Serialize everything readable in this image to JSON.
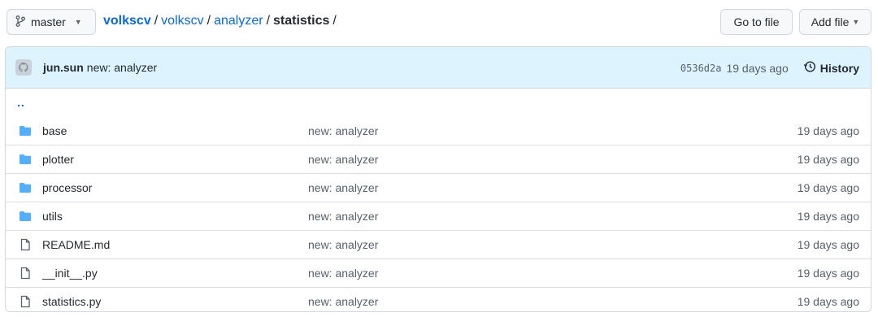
{
  "branch": {
    "label": "master"
  },
  "breadcrumb": {
    "owner": "volkscv",
    "repo": "volkscv",
    "folder": "analyzer",
    "current": "statistics",
    "sep": "/"
  },
  "buttons": {
    "goto_file": "Go to file",
    "add_file": "Add file"
  },
  "commit": {
    "author": "jun.sun",
    "message": "new: analyzer",
    "sha": "0536d2a",
    "age": "19 days ago",
    "history_label": "History"
  },
  "parent_dir": "..",
  "files": [
    {
      "name": "base",
      "type": "folder",
      "message": "new: analyzer",
      "age": "19 days ago"
    },
    {
      "name": "plotter",
      "type": "folder",
      "message": "new: analyzer",
      "age": "19 days ago"
    },
    {
      "name": "processor",
      "type": "folder",
      "message": "new: analyzer",
      "age": "19 days ago"
    },
    {
      "name": "utils",
      "type": "folder",
      "message": "new: analyzer",
      "age": "19 days ago"
    },
    {
      "name": "README.md",
      "type": "file",
      "message": "new: analyzer",
      "age": "19 days ago"
    },
    {
      "name": "__init__.py",
      "type": "file",
      "message": "new: analyzer",
      "age": "19 days ago"
    },
    {
      "name": "statistics.py",
      "type": "file",
      "message": "new: analyzer",
      "age": "19 days ago"
    }
  ],
  "colors": {
    "link": "#0969da",
    "folder": "#54aeff",
    "header_bg": "#ddf4ff"
  }
}
